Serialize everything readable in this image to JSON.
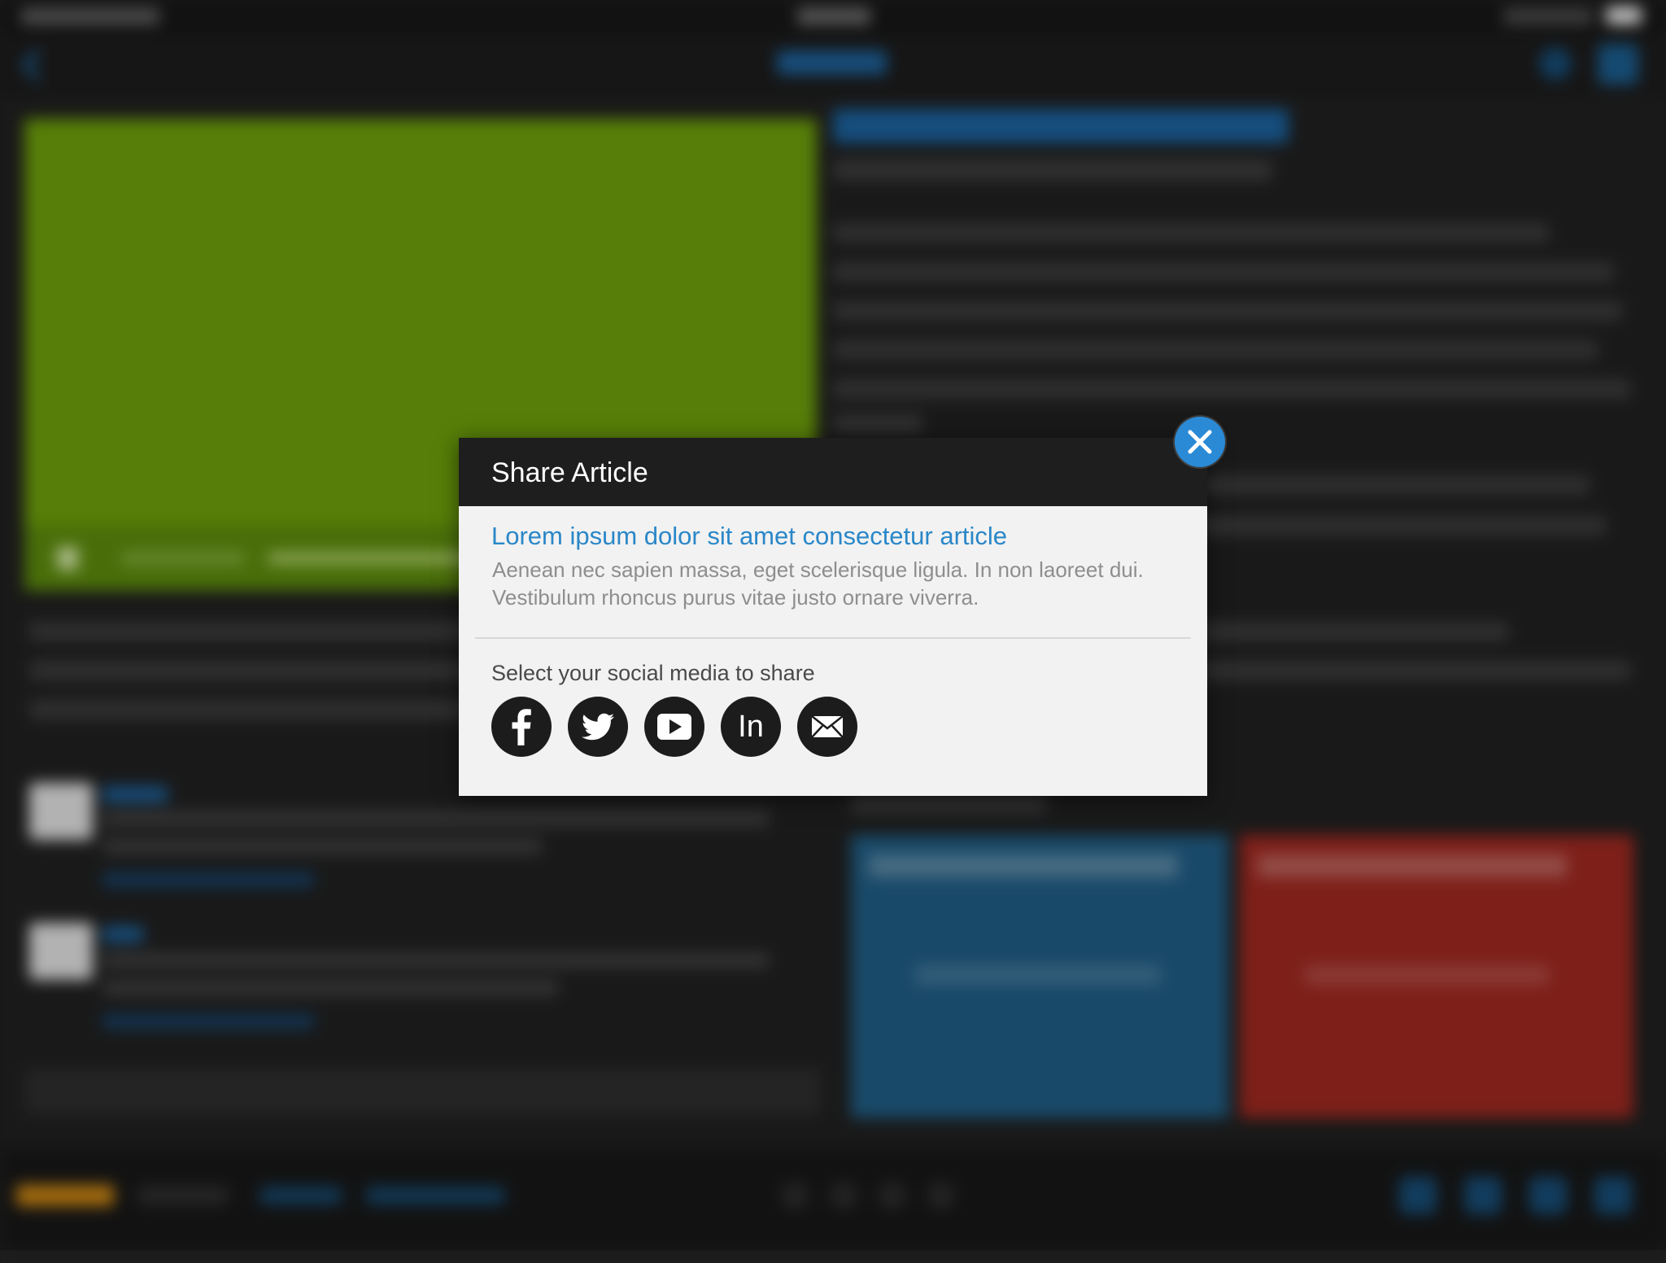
{
  "modal": {
    "title": "Share Article",
    "article_title": "Lorem ipsum dolor sit amet consectetur article",
    "article_excerpt": "Aenean nec sapien massa, eget scelerisque ligula. In non laoreet dui. Vestibulum rhoncus purus vitae justo ornare viverra.",
    "share_prompt": "Select your social media to share",
    "social_buttons": [
      {
        "icon": "facebook-icon"
      },
      {
        "icon": "twitter-icon"
      },
      {
        "icon": "youtube-icon"
      },
      {
        "icon": "linkedin-icon",
        "glyph": "In"
      },
      {
        "icon": "email-icon"
      }
    ],
    "close_icon": "close-icon"
  },
  "colors": {
    "accent_blue": "#2a87c8",
    "close_button": "#2a8ad6",
    "modal_header": "#1e1e1e",
    "modal_body": "#f2f2f2",
    "social_circle": "#1c1c1c"
  }
}
